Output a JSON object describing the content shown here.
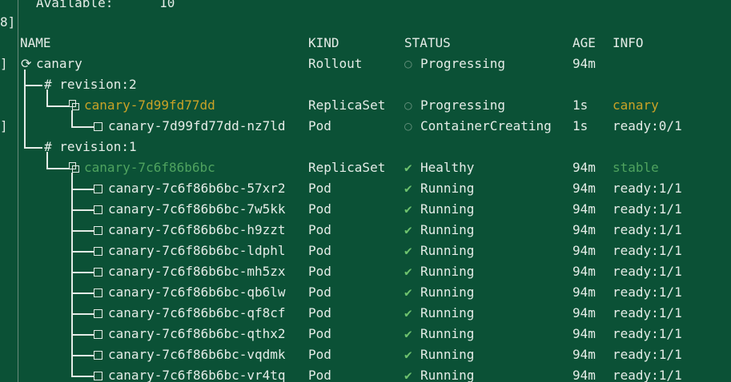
{
  "summary": {
    "label": "Available:",
    "value": "10"
  },
  "gutter_marks": [
    "8]",
    "]",
    "]"
  ],
  "header": {
    "name": "NAME",
    "kind": "KIND",
    "status": "STATUS",
    "age": "AGE",
    "info": "INFO"
  },
  "rollout": {
    "name": "canary",
    "kind": "Rollout",
    "status": "Progressing",
    "age": "94m",
    "info": ""
  },
  "revisions": [
    {
      "label": "# revision:2",
      "replicaset": {
        "name": "canary-7d99fd77dd",
        "kind": "ReplicaSet",
        "status": "Progressing",
        "age": "1s",
        "info": "canary",
        "color": "#c9a227"
      },
      "pods": [
        {
          "name": "canary-7d99fd77dd-nz7ld",
          "kind": "Pod",
          "status": "ContainerCreating",
          "age": "1s",
          "info": "ready:0/1"
        }
      ]
    },
    {
      "label": "# revision:1",
      "replicaset": {
        "name": "canary-7c6f86b6bc",
        "kind": "ReplicaSet",
        "status": "Healthy",
        "age": "94m",
        "info": "stable",
        "color": "#4fa35f"
      },
      "pods": [
        {
          "name": "canary-7c6f86b6bc-57xr2",
          "kind": "Pod",
          "status": "Running",
          "age": "94m",
          "info": "ready:1/1"
        },
        {
          "name": "canary-7c6f86b6bc-7w5kk",
          "kind": "Pod",
          "status": "Running",
          "age": "94m",
          "info": "ready:1/1"
        },
        {
          "name": "canary-7c6f86b6bc-h9zzt",
          "kind": "Pod",
          "status": "Running",
          "age": "94m",
          "info": "ready:1/1"
        },
        {
          "name": "canary-7c6f86b6bc-ldphl",
          "kind": "Pod",
          "status": "Running",
          "age": "94m",
          "info": "ready:1/1"
        },
        {
          "name": "canary-7c6f86b6bc-mh5zx",
          "kind": "Pod",
          "status": "Running",
          "age": "94m",
          "info": "ready:1/1"
        },
        {
          "name": "canary-7c6f86b6bc-qb6lw",
          "kind": "Pod",
          "status": "Running",
          "age": "94m",
          "info": "ready:1/1"
        },
        {
          "name": "canary-7c6f86b6bc-qf8cf",
          "kind": "Pod",
          "status": "Running",
          "age": "94m",
          "info": "ready:1/1"
        },
        {
          "name": "canary-7c6f86b6bc-qthx2",
          "kind": "Pod",
          "status": "Running",
          "age": "94m",
          "info": "ready:1/1"
        },
        {
          "name": "canary-7c6f86b6bc-vqdmk",
          "kind": "Pod",
          "status": "Running",
          "age": "94m",
          "info": "ready:1/1"
        },
        {
          "name": "canary-7c6f86b6bc-vr4tq",
          "kind": "Pod",
          "status": "Running",
          "age": "94m",
          "info": "ready:1/1"
        }
      ]
    }
  ],
  "icons": {
    "progressing": "○",
    "healthy": "✔",
    "rollout": "⟳"
  },
  "colors": {
    "background": "#0b5136",
    "text": "#e4ece7",
    "check": "#6ec26e",
    "hollow": "#5f8c77"
  }
}
